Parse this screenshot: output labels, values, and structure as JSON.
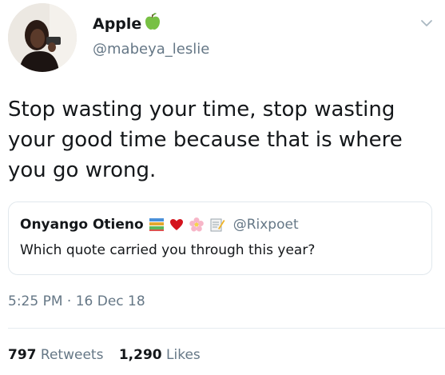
{
  "author": {
    "display_name": "Apple",
    "handle": "@mabeya_leslie"
  },
  "tweet": {
    "text": "Stop wasting your time, stop wasting your good time because that is where you go wrong."
  },
  "quoted_tweet": {
    "display_name": "Onyango Otieno",
    "handle": "@Rixpoet",
    "text": "Which quote carried you through this year?"
  },
  "timestamp": "5:25 PM · 16 Dec 18",
  "stats": {
    "retweets_count": "797",
    "retweets_label": "Retweets",
    "likes_count": "1,290",
    "likes_label": "Likes"
  },
  "colors": {
    "text_primary": "#14171a",
    "text_secondary": "#657786",
    "border": "#e1e8ed"
  },
  "icons": [
    "avatar",
    "green-apple-icon",
    "chevron-down-icon",
    "books-icon",
    "heart-icon",
    "cherry-blossom-icon",
    "memo-icon"
  ]
}
